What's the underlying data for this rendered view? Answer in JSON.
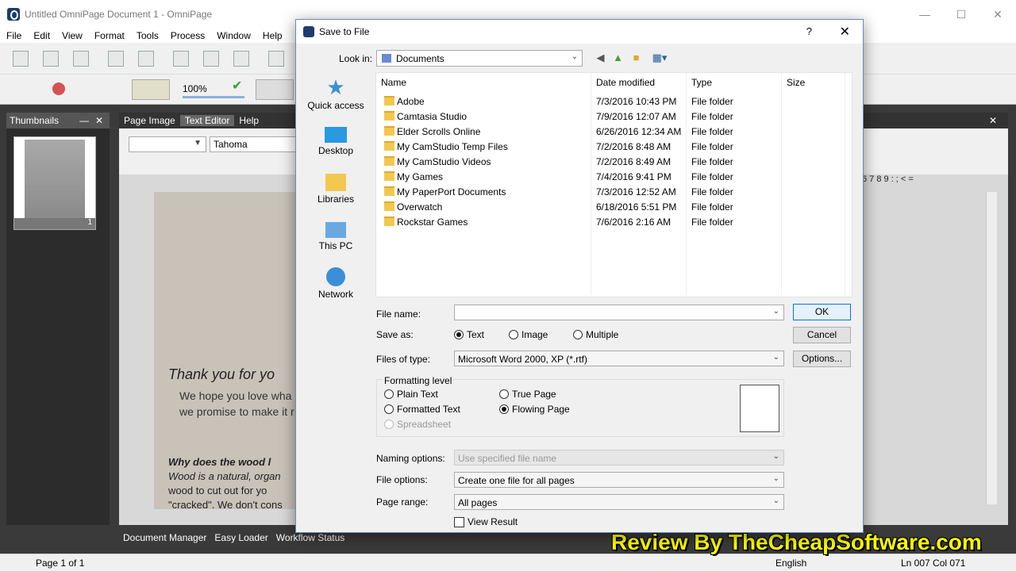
{
  "app": {
    "title": "Untitled OmniPage Document 1 - OmniPage",
    "menu": [
      "File",
      "Edit",
      "View",
      "Format",
      "Tools",
      "Process",
      "Window",
      "Help"
    ],
    "zoom": "100%",
    "thumbnails_title": "Thumbnails",
    "thumb_page_num": "1",
    "editor_tabs": [
      "Page Image",
      "Text Editor",
      "Help"
    ],
    "font_size_value": "",
    "font_name": "Tahoma",
    "ruler_chars": "6 7 8 9 : ; < =",
    "doc_heading": "Thank you for yo",
    "doc_line1": "We hope you love wha",
    "doc_line2": "we promise to make it r",
    "doc_line3": "Why does the wood l",
    "doc_line4": "Wood is a natural, organ",
    "doc_line5": "wood to cut out for yo",
    "doc_line6": "\"cracked\". We don't cons",
    "bottom_tabs": [
      "Document Manager",
      "Easy Loader",
      "Workflow Status"
    ],
    "status_page": "Page 1 of 1",
    "status_lang": "English",
    "status_pos": "Ln 007  Col 071",
    "watermark": "Review By TheCheapSoftware.com"
  },
  "dialog": {
    "title": "Save to File",
    "help": "?",
    "lookin_label": "Look in:",
    "lookin_value": "Documents",
    "places": [
      {
        "label": "Quick access",
        "icon": "star-icon"
      },
      {
        "label": "Desktop",
        "icon": "desktop-icon"
      },
      {
        "label": "Libraries",
        "icon": "libraries-icon"
      },
      {
        "label": "This PC",
        "icon": "computer-icon"
      },
      {
        "label": "Network",
        "icon": "network-icon"
      }
    ],
    "columns": [
      "Name",
      "Date modified",
      "Type",
      "Size"
    ],
    "files": [
      {
        "name": "Adobe",
        "date": "7/3/2016 10:43 PM",
        "type": "File folder"
      },
      {
        "name": "Camtasia Studio",
        "date": "7/9/2016 12:07 AM",
        "type": "File folder"
      },
      {
        "name": "Elder Scrolls Online",
        "date": "6/26/2016 12:34 AM",
        "type": "File folder"
      },
      {
        "name": "My CamStudio Temp Files",
        "date": "7/2/2016 8:48 AM",
        "type": "File folder"
      },
      {
        "name": "My CamStudio Videos",
        "date": "7/2/2016 8:49 AM",
        "type": "File folder"
      },
      {
        "name": "My Games",
        "date": "7/4/2016 9:41 PM",
        "type": "File folder"
      },
      {
        "name": "My PaperPort Documents",
        "date": "7/3/2016 12:52 AM",
        "type": "File folder"
      },
      {
        "name": "Overwatch",
        "date": "6/18/2016 5:51 PM",
        "type": "File folder"
      },
      {
        "name": "Rockstar Games",
        "date": "7/6/2016 2:16 AM",
        "type": "File folder"
      }
    ],
    "filename_label": "File name:",
    "filename_value": "",
    "saveas_label": "Save as:",
    "saveas_options": [
      "Text",
      "Image",
      "Multiple"
    ],
    "filetype_label": "Files of type:",
    "filetype_value": "Microsoft Word 2000, XP (*.rtf)",
    "formatting_title": "Formatting level",
    "formatting_options": [
      "Plain Text",
      "Formatted Text",
      "Spreadsheet",
      "True Page",
      "Flowing Page"
    ],
    "naming_label": "Naming options:",
    "naming_value": "Use specified file name",
    "fileopt_label": "File options:",
    "fileopt_value": "Create one file for all pages",
    "pagerange_label": "Page range:",
    "pagerange_value": "All pages",
    "view_result": "View Result",
    "ok": "OK",
    "cancel": "Cancel",
    "options": "Options..."
  }
}
